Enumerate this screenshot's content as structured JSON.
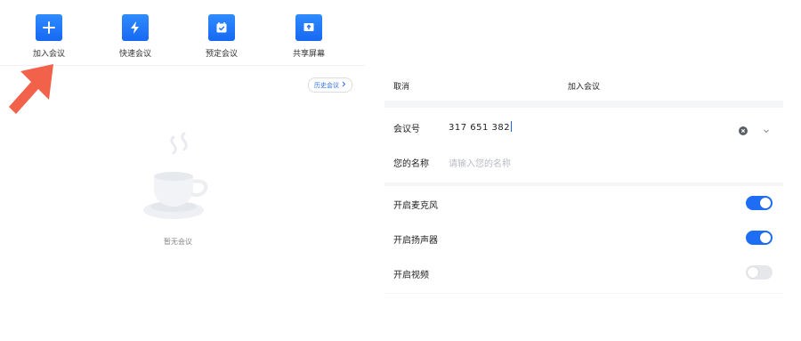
{
  "toolbar": {
    "items": [
      {
        "label": "加入会议",
        "icon": "plus-icon"
      },
      {
        "label": "快速会议",
        "icon": "lightning-icon"
      },
      {
        "label": "预定会议",
        "icon": "calendar-check-icon"
      },
      {
        "label": "共享屏幕",
        "icon": "share-screen-icon"
      }
    ]
  },
  "history_button": {
    "label": "历史会议",
    "icon": "chevron-right-icon"
  },
  "empty_state": {
    "text": "暂无会议",
    "icon": "coffee-cup-icon"
  },
  "join_panel": {
    "cancel": "取消",
    "title": "加入会议",
    "meeting_id": {
      "label": "会议号",
      "value": "317 651 382"
    },
    "name": {
      "label": "您的名称",
      "placeholder": "请输入您的名称"
    },
    "toggles": [
      {
        "label": "开启麦克风",
        "on": true
      },
      {
        "label": "开启扬声器",
        "on": true
      },
      {
        "label": "开启视频",
        "on": false
      }
    ]
  },
  "colors": {
    "accent": "#1d6ef5",
    "annotation_arrow": "#f2614a",
    "panel_bg": "#f5f6f8"
  }
}
